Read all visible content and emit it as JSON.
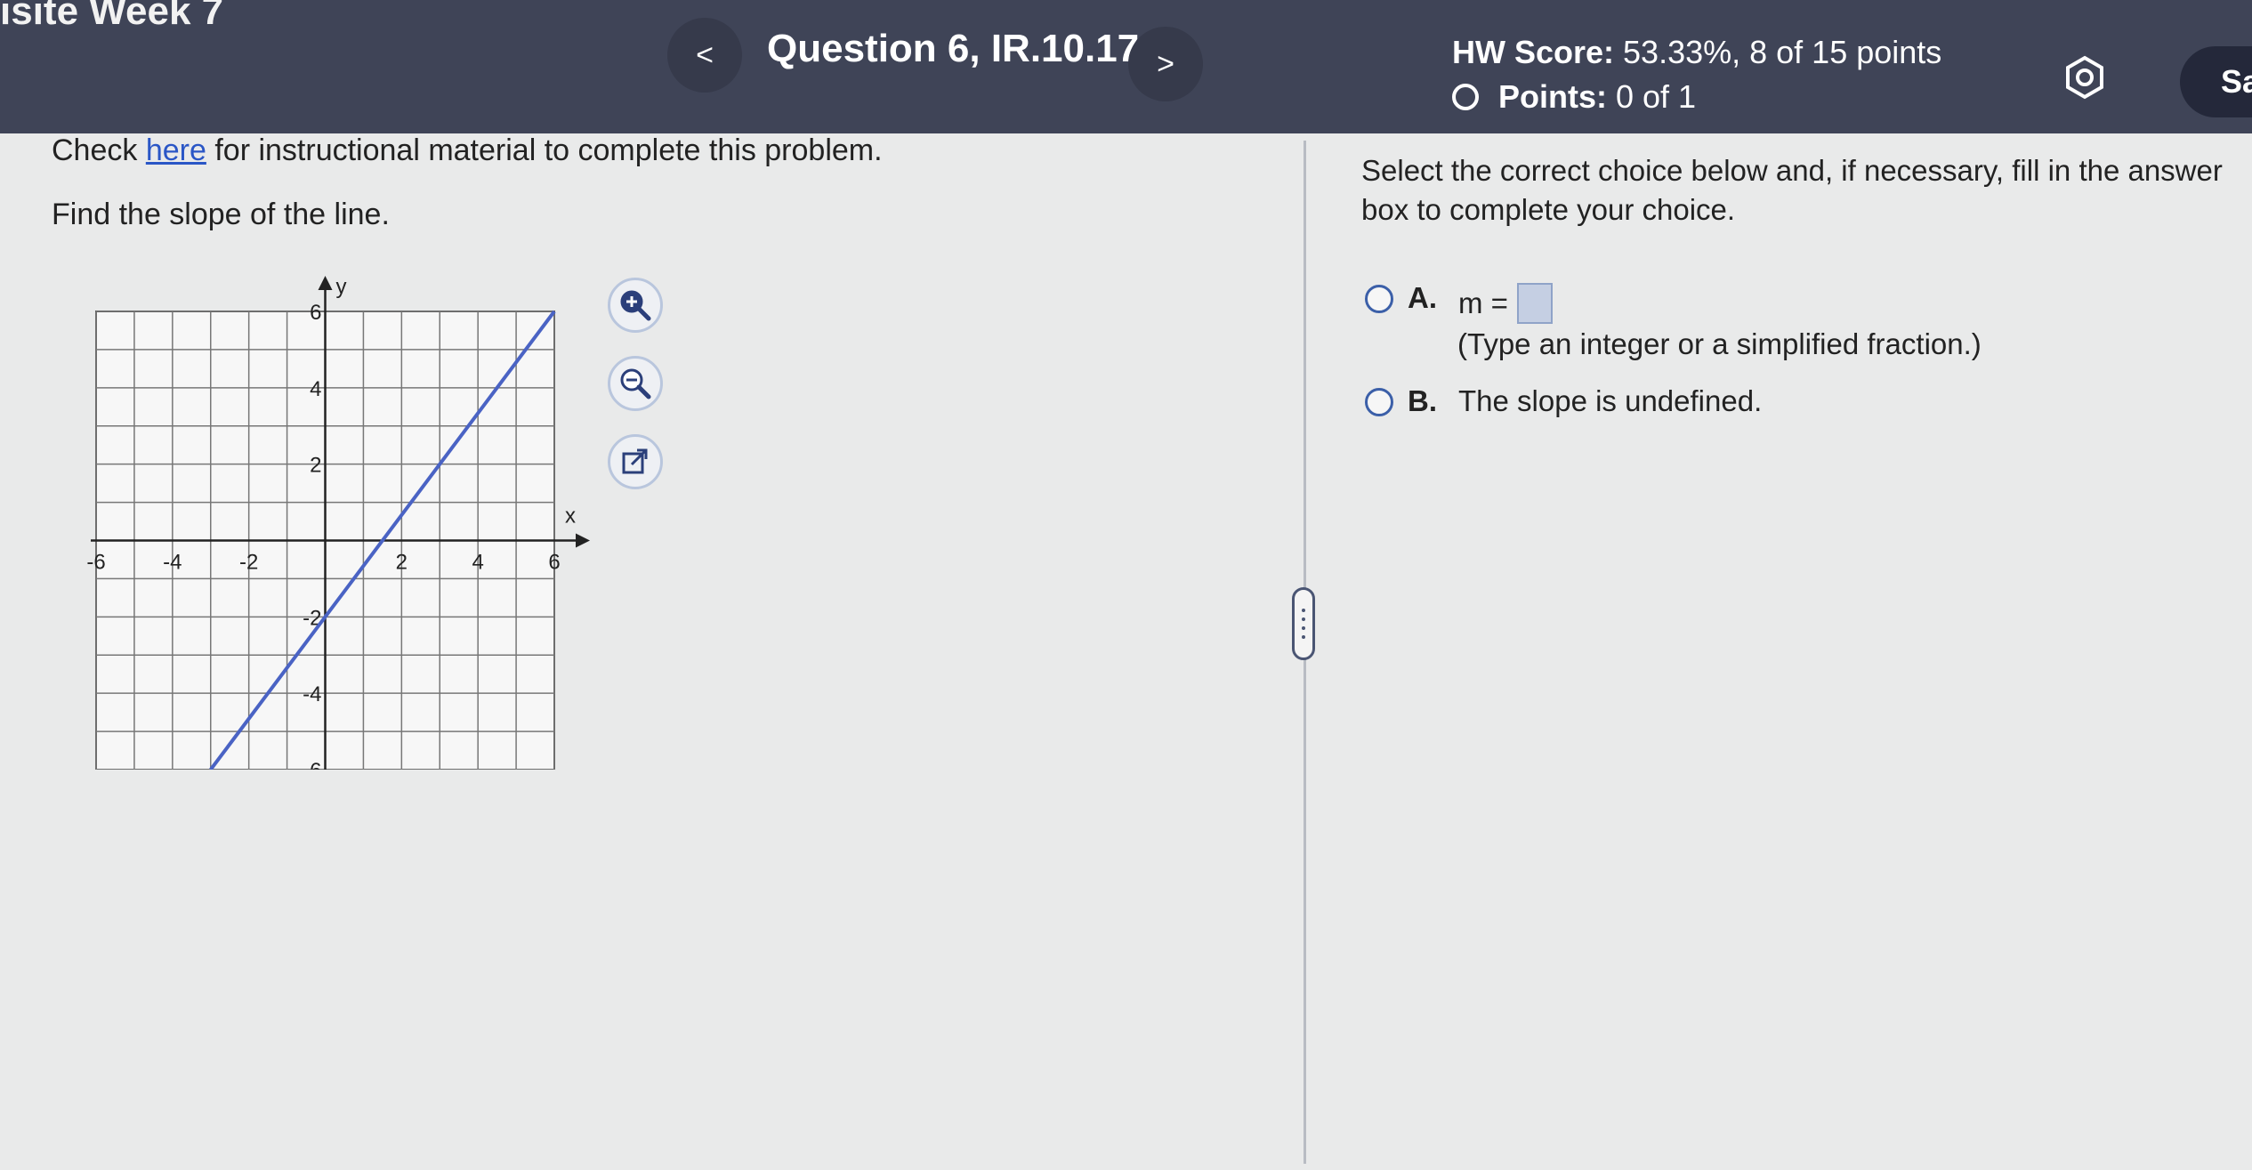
{
  "header": {
    "course_title": "isite Week 7",
    "prev_label": "<",
    "question_title": "Question 6, IR.10.17",
    "next_label": ">",
    "hw_score_label": "HW Score:",
    "hw_score_value": "53.33%, 8 of 15 points",
    "points_label": "Points:",
    "points_value": "0 of 1",
    "save_label": "Sa"
  },
  "left": {
    "check_prefix": "Check ",
    "check_link": "here",
    "check_suffix": " for instructional material to complete this problem.",
    "prompt": "Find the slope of the line."
  },
  "graph": {
    "y_axis_label": "y",
    "x_axis_label": "x",
    "x_ticks": [
      "-6",
      "-4",
      "-2",
      "2",
      "4",
      "6"
    ],
    "y_ticks": [
      "6",
      "4",
      "2",
      "-2",
      "-4",
      "-6"
    ],
    "x_range": [
      -6,
      6
    ],
    "y_range": [
      -6,
      6
    ],
    "grid": true,
    "line_color": "#4a63c4",
    "line_points": [
      [
        -3,
        -6
      ],
      [
        6,
        6
      ]
    ]
  },
  "tools": {
    "zoom_in": "zoom-in-icon",
    "zoom_out": "zoom-out-icon",
    "popout": "external-link-icon"
  },
  "right": {
    "instruction": "Select the correct choice below and, if necessary, fill in the answer box to complete your choice.",
    "choice_a_letter": "A.",
    "choice_a_text": "m =",
    "choice_a_hint": "(Type an integer or a simplified fraction.)",
    "choice_b_letter": "B.",
    "choice_b_text": "The slope is undefined."
  },
  "colors": {
    "header_bg": "#3f4457",
    "link": "#2a56c6",
    "radio": "#3b5fa8"
  }
}
